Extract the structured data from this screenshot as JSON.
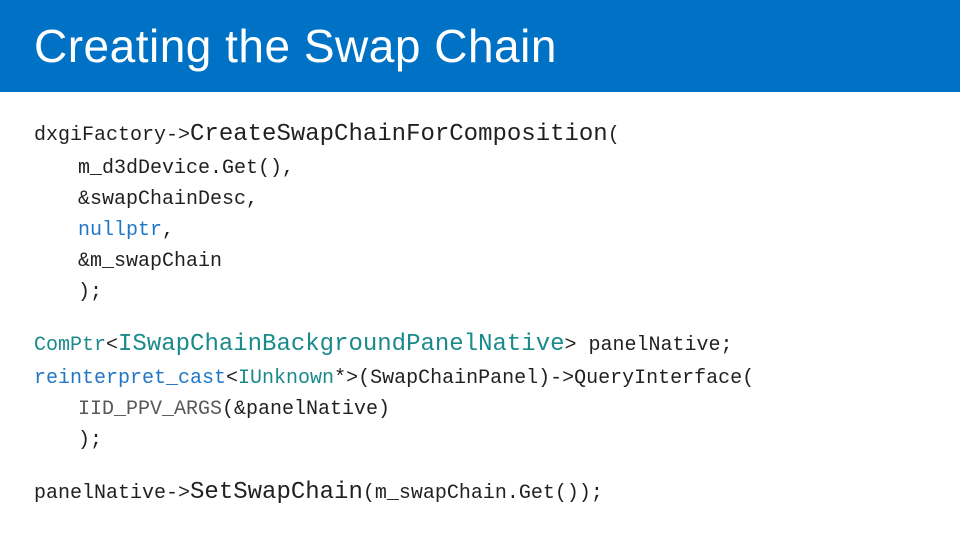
{
  "title": "Creating the Swap Chain",
  "code": {
    "l01a": "dxgiFactory->",
    "l01b": "CreateSwapChainForComposition",
    "l01c": "(",
    "l02": "m_d3dDevice.Get(),",
    "l03": "&swapChainDesc,",
    "l04": "nullptr",
    "l04b": ",",
    "l05": "&m_swapChain",
    "l06": ");",
    "l07a": "ComPtr",
    "l07b": "<",
    "l07c": "ISwapChainBackgroundPanelNative",
    "l07d": ">",
    "l07e": " panelNative;",
    "l08a": "reinterpret_cast",
    "l08b": "<",
    "l08c": "IUnknown",
    "l08d": "*>(SwapChainPanel)->QueryInterface(",
    "l09a": "IID_PPV_ARGS",
    "l09b": "(&panelNative)",
    "l10": ");",
    "l11a": "panelNative->",
    "l11b": "SetSwapChain",
    "l11c": "(m_swapChain.Get());"
  }
}
